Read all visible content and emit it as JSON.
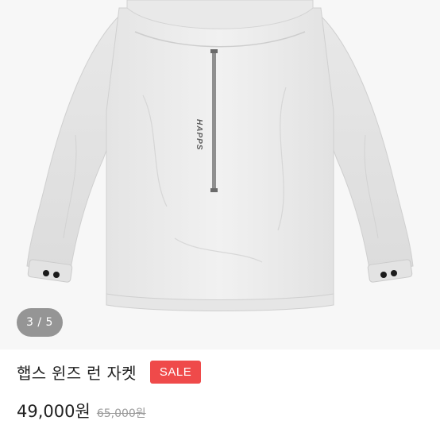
{
  "product": {
    "image_counter": "3 / 5",
    "brand_print": "HAPPS",
    "title": "햅스 윈즈 런 자켓",
    "badge": "SALE",
    "price": "49,000원",
    "original_price": "65,000원"
  },
  "colors": {
    "badge_bg": "#ef4a4a",
    "text": "#212121",
    "muted": "#9a9a9a"
  }
}
